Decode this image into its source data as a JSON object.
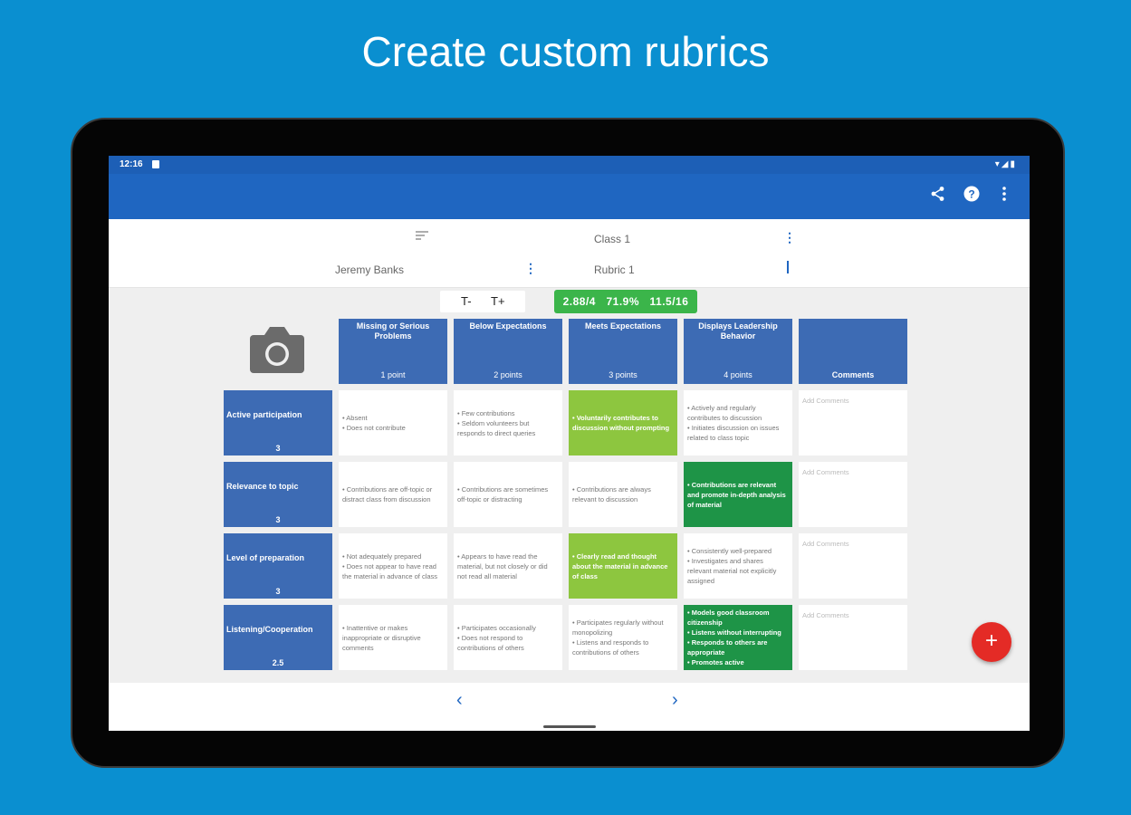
{
  "headline": "Create custom rubrics",
  "status_bar": {
    "time": "12:16",
    "system": "▾◢▮"
  },
  "app_bar": {
    "share_icon": "share-icon",
    "help_icon": "help-icon",
    "more_icon": "more-vert-icon"
  },
  "header": {
    "class_name": "Class 1",
    "student_name": "Jeremy Banks",
    "rubric_name": "Rubric 1"
  },
  "text_size": {
    "decrease": "T-",
    "increase": "T+"
  },
  "score": {
    "average": "2.88/4",
    "percent": "71.9%",
    "total": "11.5/16"
  },
  "columns": [
    {
      "title": "Missing or Serious Problems",
      "points": "1 point"
    },
    {
      "title": "Below Expectations",
      "points": "2 points"
    },
    {
      "title": "Meets Expectations",
      "points": "3 points"
    },
    {
      "title": "Displays Leadership Behavior",
      "points": "4 points"
    },
    {
      "title": "Comments",
      "points": ""
    }
  ],
  "rows": [
    {
      "title": "Active participation",
      "score": "3",
      "cells": [
        "• Absent\n• Does not contribute",
        "• Few contributions\n• Seldom volunteers but responds to direct queries",
        "• Voluntarily contributes to discussion without prompting",
        "• Actively and regularly contributes to discussion\n• Initiates discussion on issues related to class topic"
      ],
      "comment": "Add Comments"
    },
    {
      "title": "Relevance to topic",
      "score": "3",
      "cells": [
        "• Contributions are off-topic or distract class from discussion",
        "• Contributions are sometimes off-topic or distracting",
        "• Contributions are always relevant to discussion",
        "• Contributions are relevant and promote in-depth analysis of material"
      ],
      "comment": "Add Comments"
    },
    {
      "title": "Level of preparation",
      "score": "3",
      "cells": [
        "• Not adequately prepared\n• Does not appear to have read the material in advance of class",
        "• Appears to have read the material, but not closely or did not read all material",
        "• Clearly read and thought about the material in advance of class",
        "• Consistently well-prepared\n• Investigates and shares relevant material not explicitly assigned"
      ],
      "comment": "Add Comments"
    },
    {
      "title": "Listening/Cooperation",
      "score": "2.5",
      "cells": [
        "• Inattentive or makes inappropriate or disruptive comments",
        "• Participates occasionally\n• Does not respond to contributions of others",
        "• Participates regularly without monopolizing\n• Listens and responds to contributions of others",
        "• Models good classroom citizenship\n• Listens without interrupting\n• Responds to others are appropriate\n• Promotes active"
      ],
      "comment": "Add Comments"
    }
  ],
  "selected": [
    [
      2,
      "lime"
    ],
    [
      3,
      "green"
    ],
    [
      2,
      "lime"
    ],
    [
      3,
      "green"
    ]
  ],
  "colors": {
    "primary": "#1f66c1",
    "header_cell": "#3d6bb4",
    "lime": "#8dc63f",
    "green": "#1e9447",
    "fab": "#e42b26",
    "background": "#0a8fd0"
  },
  "fab_icon": "add-icon",
  "nav": {
    "prev_icon": "chevron-left-icon",
    "next_icon": "chevron-right-icon"
  }
}
